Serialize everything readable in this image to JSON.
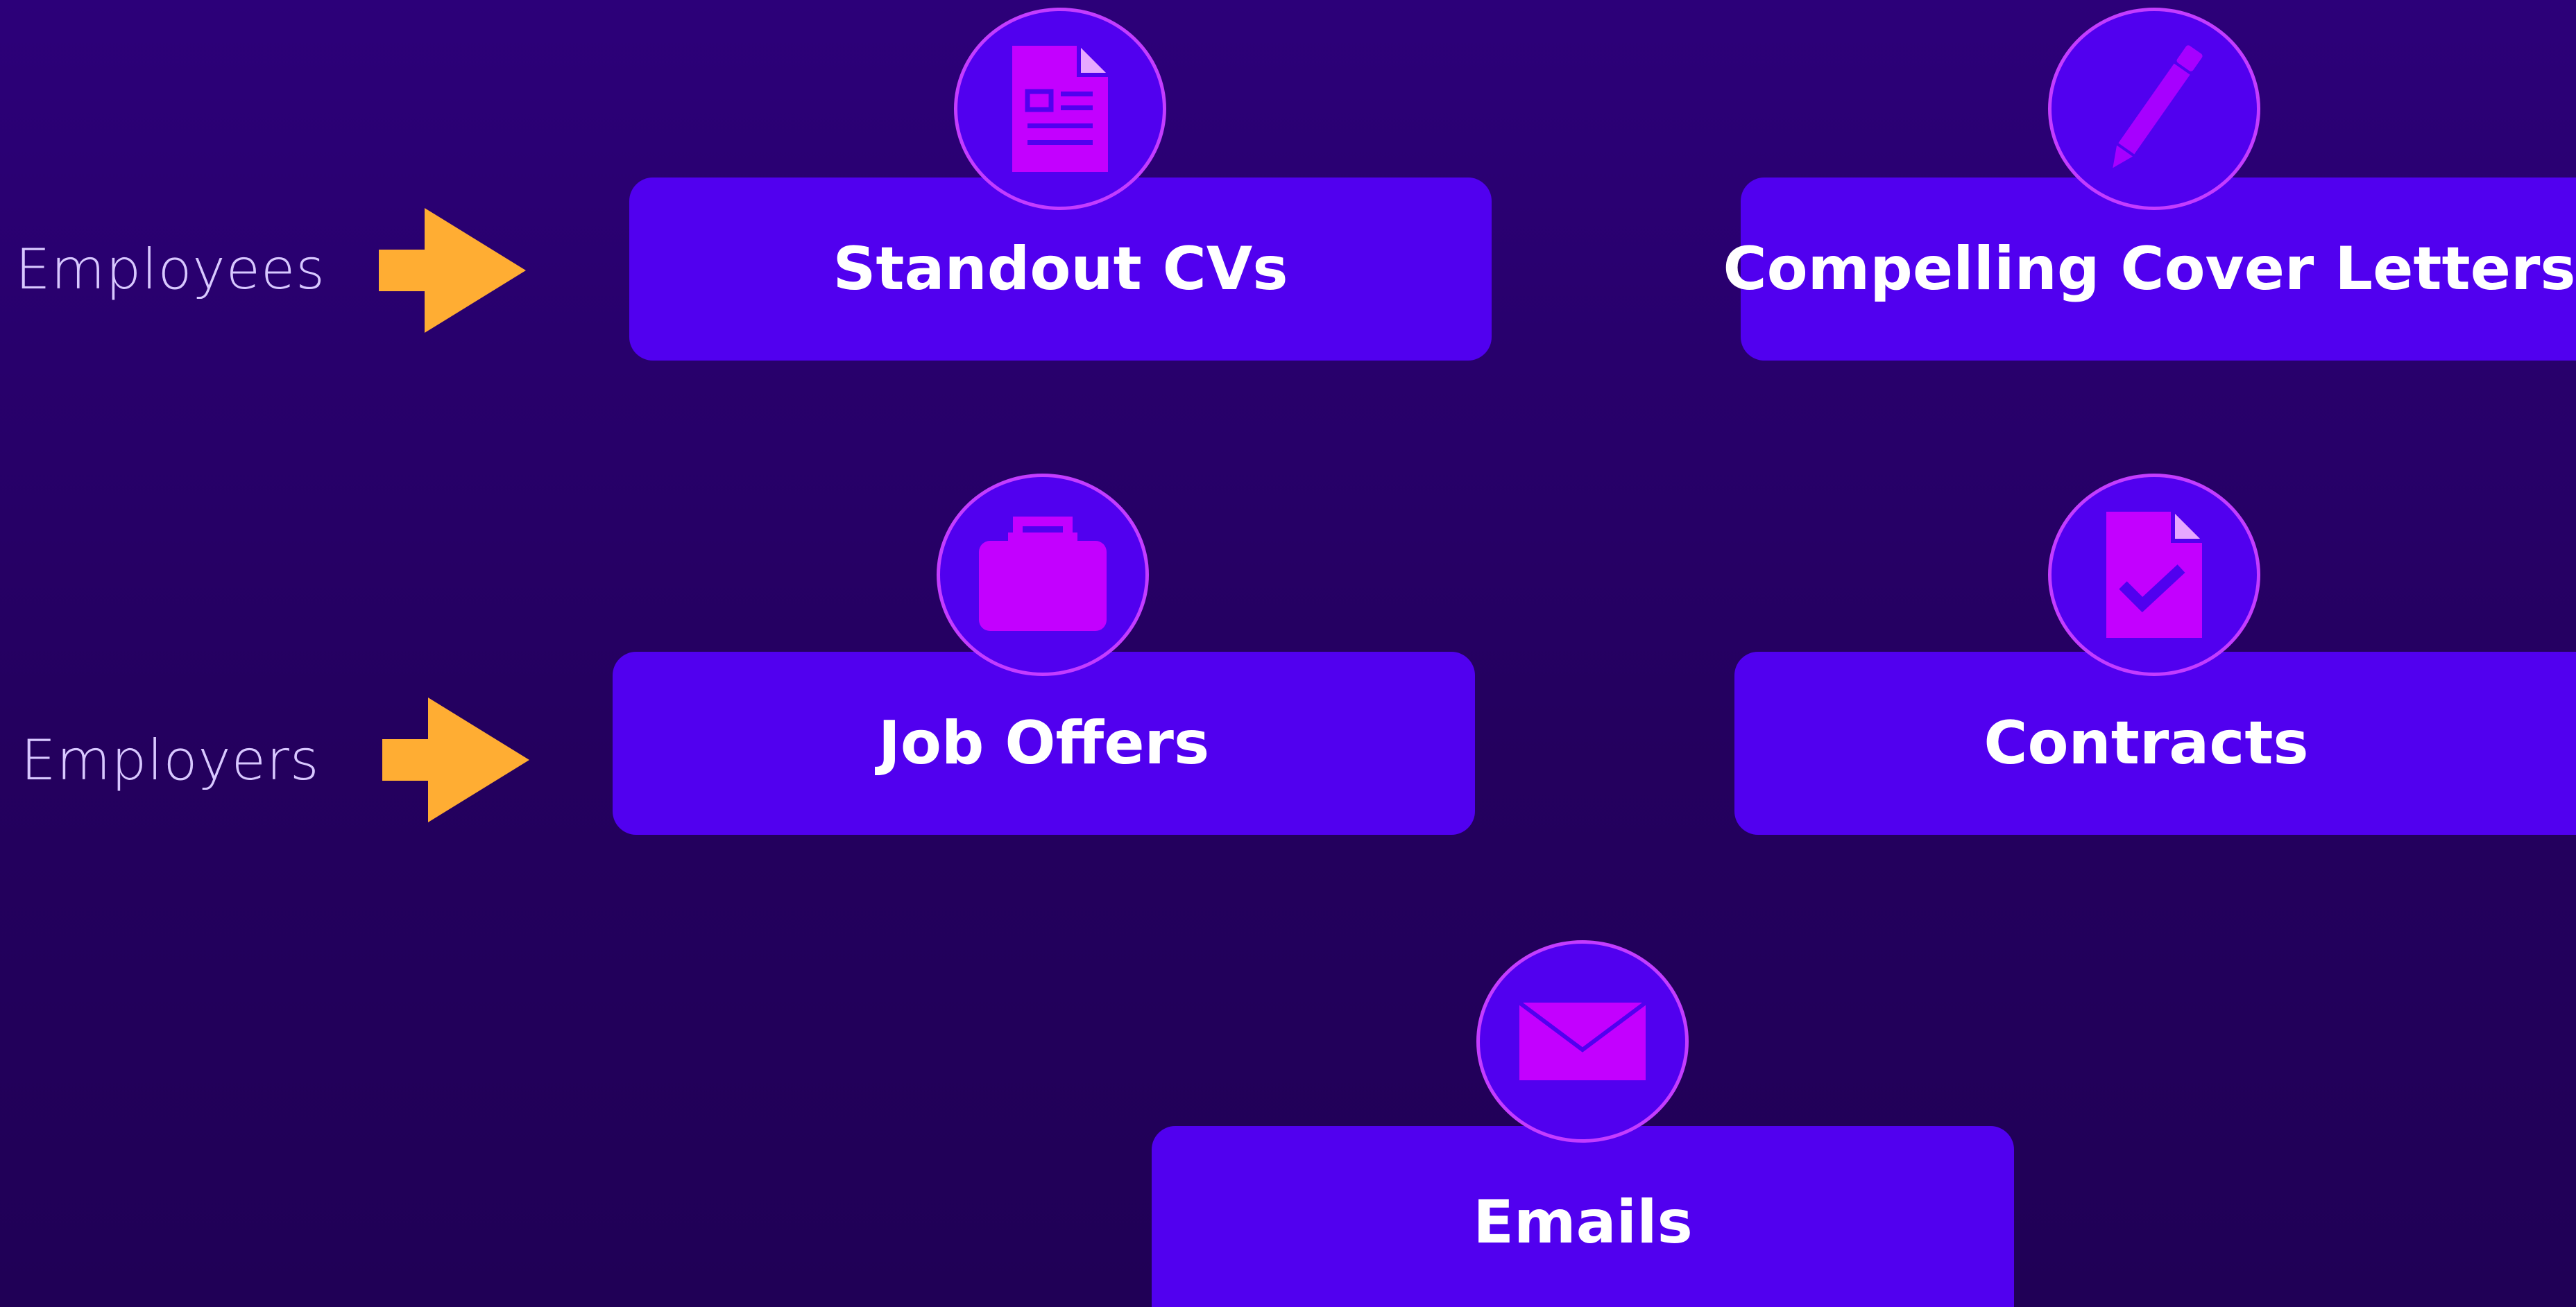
{
  "audiences": [
    {
      "label": "Employees"
    },
    {
      "label": "Employers"
    }
  ],
  "cards": {
    "cvs": {
      "label": "Standout CVs",
      "icon": "document-icon"
    },
    "cover_letters": {
      "label": "Compelling Cover Letters",
      "icon": "pencil-icon"
    },
    "job_offers": {
      "label": "Job Offers",
      "icon": "briefcase-icon"
    },
    "contracts": {
      "label": "Contracts",
      "icon": "contract-check-icon"
    },
    "emails": {
      "label": "Emails",
      "icon": "envelope-icon"
    }
  },
  "colors": {
    "background_top": "#2c0079",
    "background_bottom": "#200056",
    "card": "#5100ef",
    "icon_fill": "#c300ff",
    "circle_border": "#c43cff",
    "arrow": "#ffad33",
    "label_text": "#d8c8ff",
    "card_text": "#ffffff"
  }
}
